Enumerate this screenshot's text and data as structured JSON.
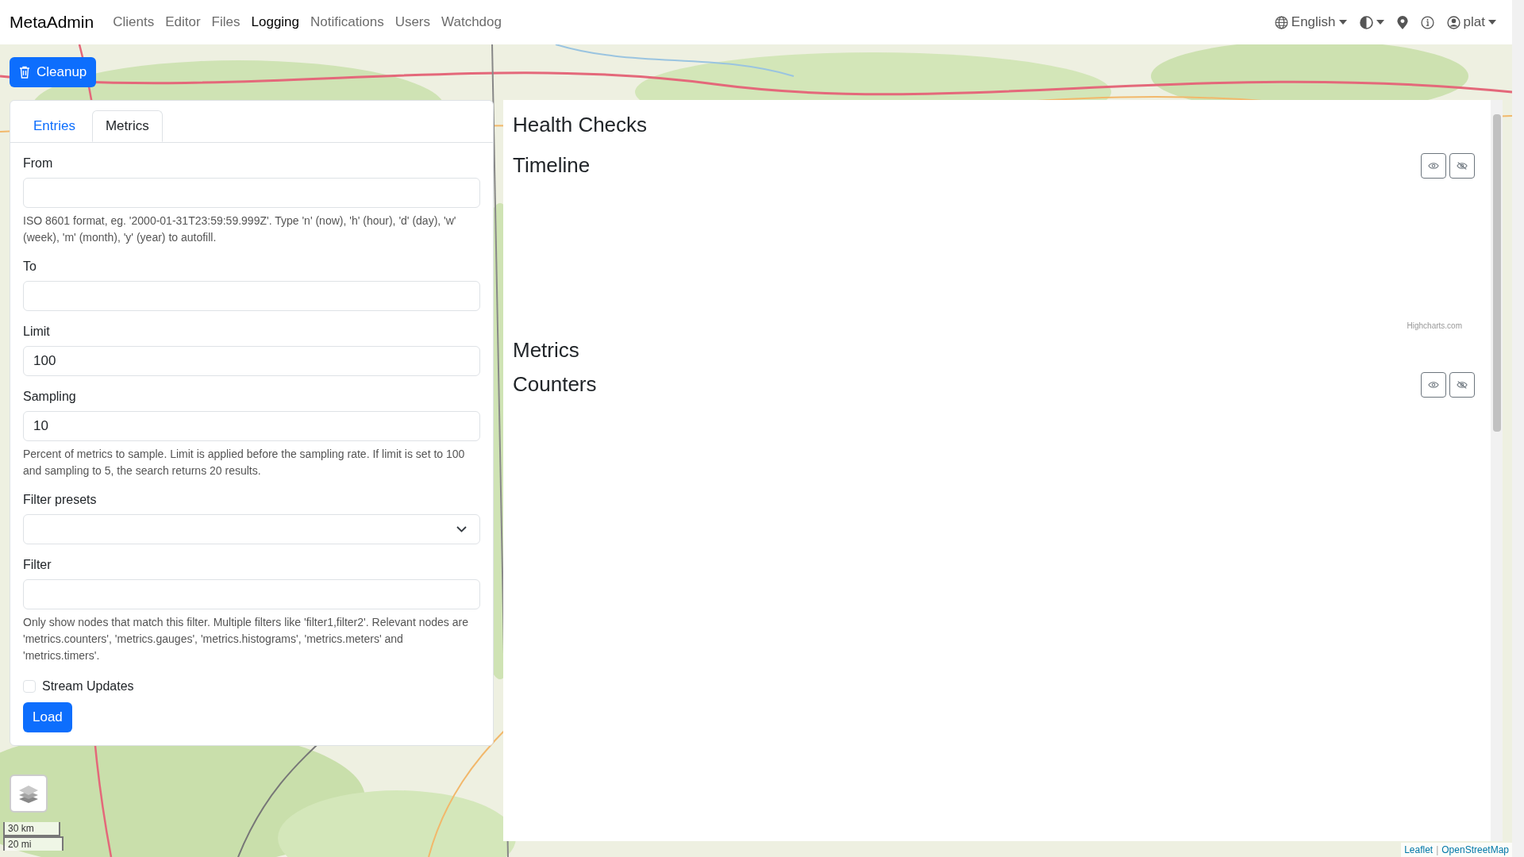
{
  "navbar": {
    "brand": "MetaAdmin",
    "links": [
      {
        "label": "Clients",
        "selected": false
      },
      {
        "label": "Editor",
        "selected": false
      },
      {
        "label": "Files",
        "selected": false
      },
      {
        "label": "Logging",
        "selected": true
      },
      {
        "label": "Notifications",
        "selected": false
      },
      {
        "label": "Users",
        "selected": false
      },
      {
        "label": "Watchdog",
        "selected": false
      }
    ],
    "language": "English",
    "user": "plat"
  },
  "cleanup_button": "Cleanup",
  "tabs": [
    {
      "label": "Entries",
      "selected": false
    },
    {
      "label": "Metrics",
      "selected": true
    }
  ],
  "form": {
    "fields": [
      {
        "kind": "input",
        "label": "From",
        "help": "ISO 8601 format, eg. '2000-01-31T23:59:59.999Z'. Type 'n' (now), 'h' (hour), 'd' (day), 'w' (week), 'm' (month), 'y' (year) to autofill."
      },
      {
        "kind": "input",
        "label": "To"
      },
      {
        "kind": "input",
        "label": "Limit",
        "value": "100"
      },
      {
        "kind": "input",
        "label": "Sampling",
        "value": "10",
        "help": "Percent of metrics to sample. Limit is applied before the sampling rate. If limit is set to 100 and sampling to 5, the search returns 20 results."
      },
      {
        "kind": "select",
        "label": "Filter presets"
      },
      {
        "kind": "input",
        "label": "Filter",
        "help": "Only show nodes that match this filter. Multiple filters like 'filter1,filter2'. Relevant nodes are 'metrics.counters', 'metrics.gauges', 'metrics.histograms', 'metrics.meters' and 'metrics.timers'."
      }
    ],
    "stream_updates": {
      "label": "Stream Updates",
      "checked": false
    },
    "load_button": "Load"
  },
  "health": {
    "title": "Health Checks",
    "sections": [
      {
        "kind": "chart",
        "title": "Timeline",
        "credit": "Highcharts.com"
      },
      {
        "kind": "heading",
        "title": "Metrics"
      },
      {
        "kind": "chart",
        "title": "Counters"
      }
    ]
  },
  "map": {
    "kind": "picture",
    "scale": [
      "30 km",
      "20 mi"
    ],
    "attribution": [
      "Leaflet",
      "OpenStreetMap"
    ],
    "attribution_separator": "|"
  }
}
